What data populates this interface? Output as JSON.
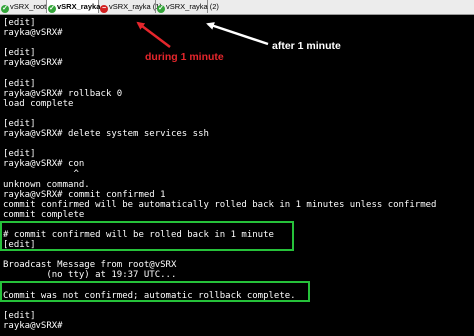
{
  "tabs": [
    {
      "label": "vSRX_root",
      "status": "ok",
      "active": false
    },
    {
      "label": "vSRX_rayka",
      "status": "ok",
      "active": true
    },
    {
      "label": "vSRX_rayka (1)",
      "status": "error",
      "active": false
    },
    {
      "label": "vSRX_rayka (2)",
      "status": "ok",
      "active": false
    }
  ],
  "terminal_lines": [
    "[edit]",
    "rayka@vSRX#",
    "",
    "[edit]",
    "rayka@vSRX#",
    "",
    "[edit]",
    "rayka@vSRX# rollback 0",
    "load complete",
    "",
    "[edit]",
    "rayka@vSRX# delete system services ssh",
    "",
    "[edit]",
    "rayka@vSRX# con",
    "             ^",
    "unknown command.",
    "rayka@vSRX# commit confirmed 1",
    "commit confirmed will be automatically rolled back in 1 minutes unless confirmed",
    "commit complete",
    "",
    "# commit confirmed will be rolled back in 1 minute",
    "[edit]",
    "",
    "Broadcast Message from root@vSRX",
    "        (no tty) at 19:37 UTC...",
    "",
    "Commit was not confirmed; automatic rollback complete.",
    "",
    "[edit]",
    "rayka@vSRX#"
  ],
  "annotations": {
    "during": "during 1 minute",
    "after": "after 1 minute"
  },
  "colors": {
    "terminal_bg": "#000000",
    "terminal_fg": "#ffffff",
    "highlight_box": "#26c13a",
    "arrow_red": "#e5262c",
    "arrow_white": "#ffffff",
    "tab_ok": "#34a63a",
    "tab_error": "#d21f1f"
  }
}
